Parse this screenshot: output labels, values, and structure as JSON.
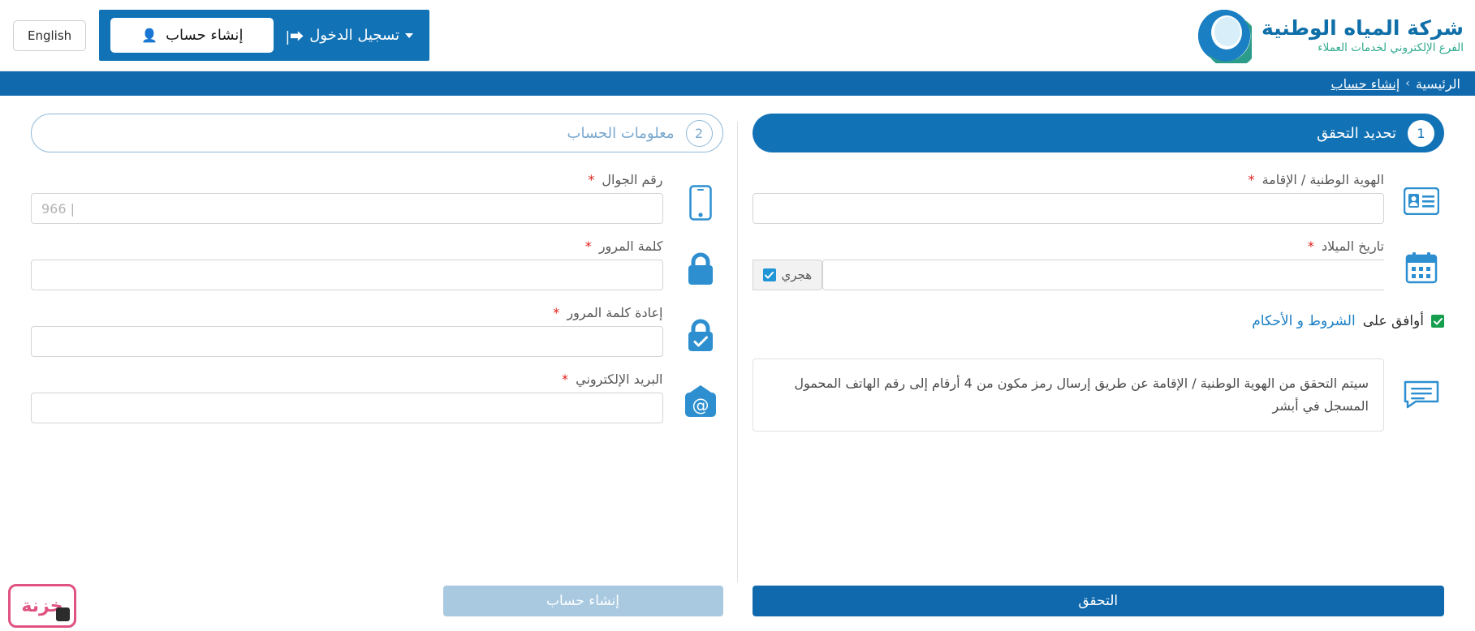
{
  "header": {
    "brand_name": "شركة المياه الوطنية",
    "brand_sub": "الفرع الإلكتروني لخدمات العملاء",
    "login_label": "تسجيل الدخول",
    "create_account_label": "إنشاء حساب",
    "english_label": "English",
    "logo_icon": "water-drop-circle-logo",
    "signin_icon": "sign-in-icon",
    "person_icon": "person-icon",
    "caret_icon": "chevron-down-icon"
  },
  "breadcrumb": {
    "home": "الرئيسية",
    "separator": "›",
    "current": "إنشاء حساب"
  },
  "steps": {
    "step1": {
      "number": "1",
      "label": "تحديد التحقق",
      "state": "active"
    },
    "step2": {
      "number": "2",
      "label": "معلومات الحساب",
      "state": "inactive"
    }
  },
  "verification": {
    "national_id": {
      "label": "الهوية الوطنية / الإقامة",
      "required": "*",
      "value": "",
      "placeholder": "",
      "icon": "id-card-icon"
    },
    "birth_date": {
      "label": "تاريخ الميلاد",
      "required": "*",
      "value": "",
      "placeholder": "",
      "icon": "calendar-icon",
      "hijri_label": "هجري",
      "hijri_checked": true
    },
    "terms": {
      "checked": true,
      "prefix": "أوافق على ",
      "link_text": "الشروط و الأحكام"
    },
    "note": {
      "icon": "comment-icon",
      "text": "سيتم التحقق من الهوية الوطنية / الإقامة عن طريق إرسال رمز مكون من 4 أرقام إلى رقم الهاتف المحمول المسجل في أبشر"
    },
    "submit_label": "التحقق"
  },
  "account_info": {
    "mobile": {
      "label": "رقم الجوال",
      "required": "*",
      "value": "",
      "placeholder": "966 |",
      "icon": "mobile-phone-icon"
    },
    "password": {
      "label": "كلمة المرور",
      "required": "*",
      "value": "",
      "placeholder": "",
      "icon": "lock-icon"
    },
    "confirm_password": {
      "label": "إعادة كلمة المرور",
      "required": "*",
      "value": "",
      "placeholder": "",
      "icon": "lock-check-icon"
    },
    "email": {
      "label": "البريد الإلكتروني",
      "required": "*",
      "value": "",
      "placeholder": "",
      "icon": "email-at-icon"
    },
    "submit_label": "إنشاء حساب"
  },
  "watermark": {
    "text": "خزنة",
    "icon": "watermark-logo"
  },
  "colors": {
    "brand_blue": "#0f69ac",
    "header_blue": "#1272b6",
    "brand_green": "#2faa8f",
    "link_blue": "#1b7fc4",
    "required_red": "#e0201b",
    "check_green": "#169e4f",
    "icon_blue": "#2d8fd0",
    "disabled_blue": "#a8c9e0"
  }
}
